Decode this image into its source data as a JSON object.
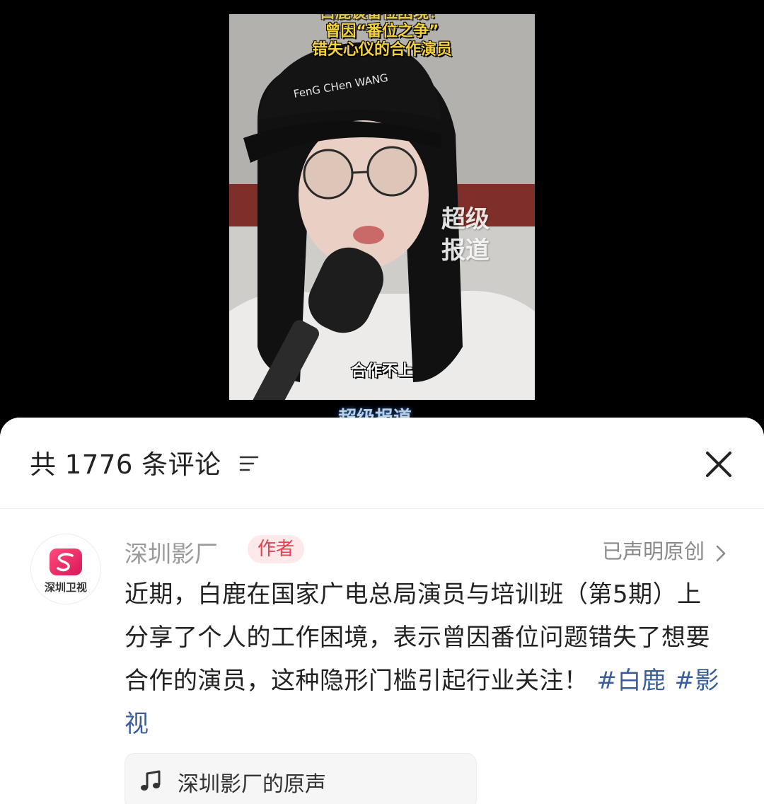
{
  "video": {
    "caption_line0": "白鹿谈番位困境！",
    "caption_line1": "曾因“番位之争”",
    "caption_line2": "错失心仪的合作演员",
    "cap_text": "FenG CHen WANG",
    "watermark_line1": "超级",
    "watermark_line2": "报道",
    "subtitle": "合作不上",
    "bottom_watermark": "超级报道"
  },
  "comments": {
    "header_title": "共 1776 条评论",
    "sort_icon": "sort-lines-icon",
    "close_icon": "close-icon"
  },
  "author_post": {
    "avatar_label": "深圳卫视",
    "author_name": "深圳影厂",
    "author_badge": "作者",
    "original_label": "已声明原创",
    "text": "近期，白鹿在国家广电总局演员与培训班（第5期）上分享了个人的工作困境，表示曾因番位问题错失了想要合作的演员，这种隐形门槛引起行业关注！",
    "hashtags": [
      "#白鹿",
      "#影视"
    ],
    "music_label": "深圳影厂的原声",
    "music_icon": "music-note-icon"
  },
  "colors": {
    "badge_text": "#e2414f",
    "badge_bg": "#fde9ea",
    "hashtag": "#3b5d99",
    "caption": "#f6d23a"
  }
}
